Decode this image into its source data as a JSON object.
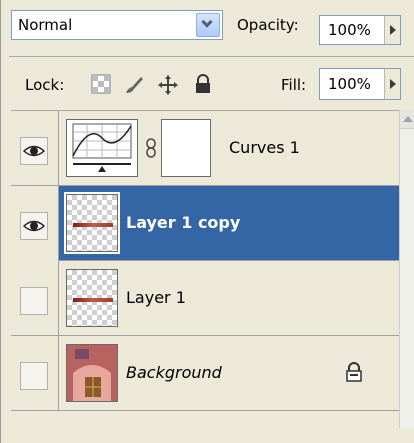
{
  "blend_mode": {
    "value": "Normal"
  },
  "opacity": {
    "label": "Opacity:",
    "value": "100%"
  },
  "lock": {
    "label": "Lock:"
  },
  "fill": {
    "label": "Fill:",
    "value": "100%"
  },
  "layers": [
    {
      "name": "Curves 1",
      "visible": true,
      "type": "adjustment"
    },
    {
      "name": "Layer 1 copy",
      "visible": true,
      "selected": true,
      "type": "pixel"
    },
    {
      "name": "Layer 1",
      "visible": false,
      "type": "pixel"
    },
    {
      "name": "Background",
      "visible": false,
      "locked": true,
      "type": "background"
    }
  ],
  "colors": {
    "selection": "#3465a4",
    "panel": "#ece9d8"
  }
}
